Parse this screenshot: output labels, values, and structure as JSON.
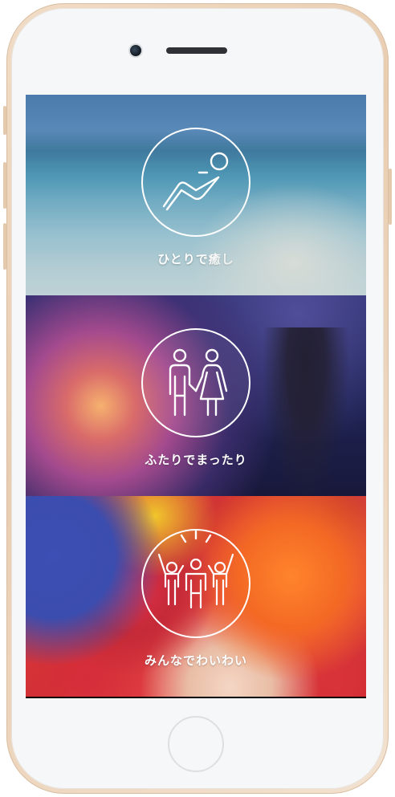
{
  "panels": [
    {
      "label": "ひとりで癒し",
      "icon": "relaxing-person-icon"
    },
    {
      "label": "ふたりでまったり",
      "icon": "couple-icon"
    },
    {
      "label": "みんなでわいわい",
      "icon": "group-cheering-icon"
    }
  ],
  "colors": {
    "frame": "#e9cdb1",
    "label": "#ffffff"
  }
}
